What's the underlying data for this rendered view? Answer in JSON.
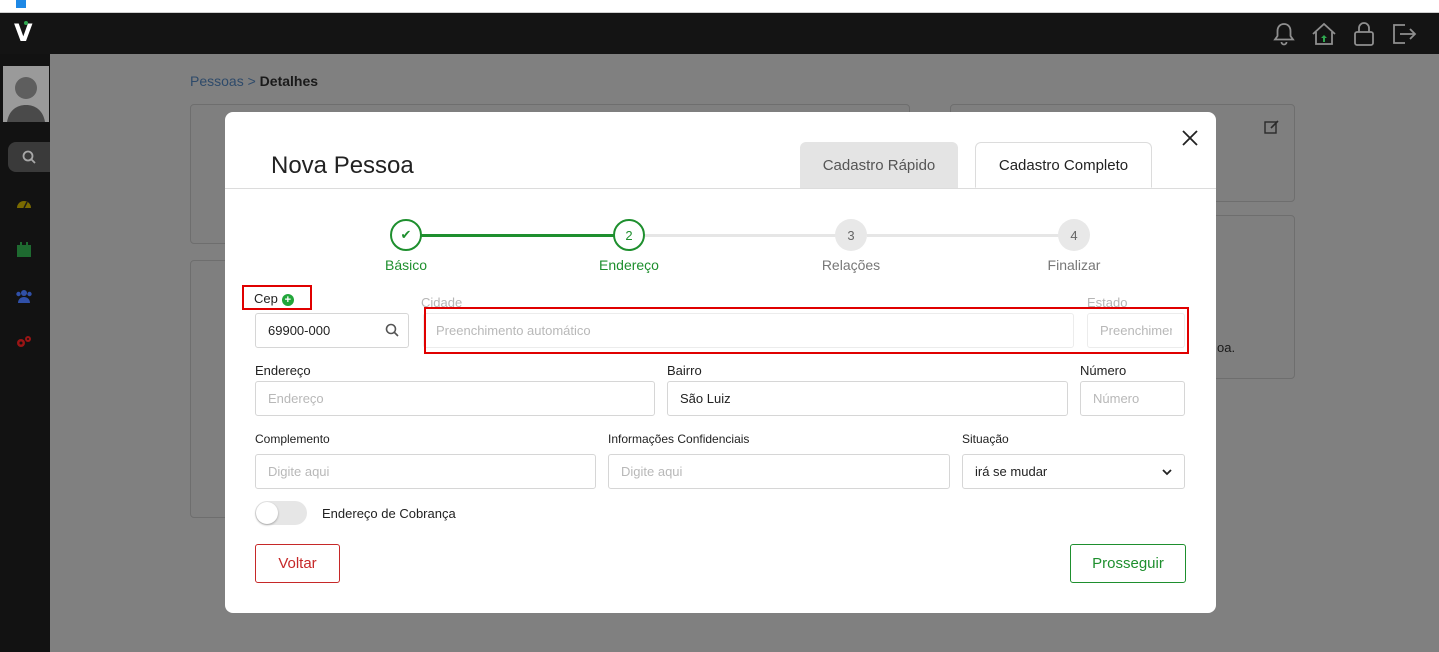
{
  "breadcrumb": {
    "parent": "Pessoas",
    "separator": ">",
    "current": "Detalhes"
  },
  "background": {
    "fragment_text": "oa."
  },
  "modal": {
    "title": "Nova Pessoa",
    "tabs": {
      "quick": "Cadastro Rápido",
      "full": "Cadastro Completo"
    },
    "steps": [
      {
        "number": "✔",
        "label": "Básico",
        "state": "done"
      },
      {
        "number": "2",
        "label": "Endereço",
        "state": "active"
      },
      {
        "number": "3",
        "label": "Relações",
        "state": "pending"
      },
      {
        "number": "4",
        "label": "Finalizar",
        "state": "pending"
      }
    ],
    "form": {
      "cep": {
        "label": "Cep",
        "value": "69900-000"
      },
      "cidade": {
        "label": "Cidade",
        "placeholder": "Preenchimento automático"
      },
      "estado": {
        "label": "Estado",
        "placeholder": "Preenchimer"
      },
      "endereco": {
        "label": "Endereço",
        "placeholder": "Endereço"
      },
      "bairro": {
        "label": "Bairro",
        "value": "São Luiz"
      },
      "numero": {
        "label": "Número",
        "placeholder": "Número"
      },
      "complemento": {
        "label": "Complemento",
        "placeholder": "Digite aqui"
      },
      "info_confidenciais": {
        "label": "Informações Confidenciais",
        "placeholder": "Digite aqui"
      },
      "situacao": {
        "label": "Situação",
        "value": "irá se mudar"
      },
      "cobranca": {
        "label": "Endereço de Cobrança",
        "enabled": false
      }
    },
    "buttons": {
      "back": "Voltar",
      "next": "Prosseguir"
    }
  },
  "colors": {
    "accent_green": "#1e8f2e",
    "danger_red": "#c62828",
    "highlight_red": "#e00000"
  },
  "icons": {
    "topbar": [
      "bell-icon",
      "home-icon",
      "lock-icon",
      "logout-icon"
    ],
    "sidebar": [
      "search-icon",
      "dashboard-icon",
      "calendar-icon",
      "people-icon",
      "gears-icon"
    ]
  }
}
